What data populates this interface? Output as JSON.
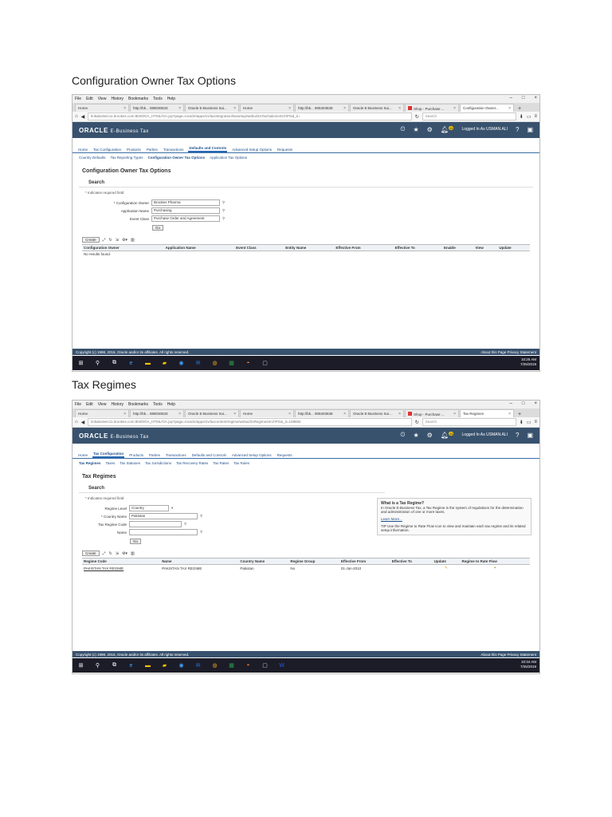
{
  "page": {
    "heading1": "Configuration Owner Tax Options",
    "heading2": "Tax Regimes"
  },
  "browser": {
    "menu": [
      "File",
      "Edit",
      "View",
      "History",
      "Bookmarks",
      "Tools",
      "Help"
    ],
    "window_controls": [
      "–",
      "□",
      "×"
    ]
  },
  "shot1": {
    "tabs": [
      "Home",
      "http://bk... 988030633",
      "Oracle E-Business Sui...",
      "Home",
      "http://bk... 905303638",
      "Oracle E-Business Sui...",
      "Shop - Purchase ...",
      "Configuration Owner..."
    ],
    "url": "linkabotsec11.brookes.com:8040/OA_HTML/OA.jsp?page=/oracle/apps/zx/taxintegration/taxsetup/webui/ZxTaxOptionsSrchPG&_ti=",
    "search_placeholder": "Search",
    "logo": "ORACLE",
    "product": "E-Business Tax",
    "logged_in": "Logged In As USMAN.ALI",
    "notif_count": "44",
    "nav_tabs": [
      "Home",
      "Tax Configuration",
      "Products",
      "Parties",
      "Transactions",
      "Defaults and Controls",
      "Advanced Setup Options",
      "Requests"
    ],
    "sub_tabs": [
      "Country Defaults",
      "Tax Reporting Types",
      "Configuration Owner Tax Options",
      "Application Tax Options"
    ],
    "title": "Configuration Owner Tax Options",
    "search_title": "Search",
    "required_note": "* Indicates required field",
    "fields": [
      {
        "label": "Configuration Owner",
        "value": "Brookes Pharma"
      },
      {
        "label": "Application Name",
        "value": "Purchasing"
      },
      {
        "label": "Event Class",
        "value": "Purchase Order and Agreement"
      }
    ],
    "go": "Go",
    "create": "Create",
    "columns": [
      "Configuration Owner",
      "Application Name",
      "Event Class",
      "Entity Name",
      "Effective From",
      "Effective To",
      "Enable",
      "View",
      "Update"
    ],
    "no_results": "No results found.",
    "copyright": "Copyright (c) 1998, 2016, Oracle and/or its affiliates. All rights reserved.",
    "footer_links": "About this Page   Privacy Statement",
    "clock_time": "10:25 AM",
    "clock_date": "7/25/2019"
  },
  "shot2": {
    "tabs": [
      "Home",
      "http://bk... 988030633",
      "Oracle E-Business Sui...",
      "Home",
      "http://bk... 905303638",
      "Oracle E-Business Sui...",
      "Shop - Purchase ...",
      "Tax Regimes"
    ],
    "url": "linkabotsec11.brookes.com:8040/OA_HTML/OA.jsp?page=/oracle/apps/zx/taxcontent/regime/webui/ZxRegimesSrchPG&_ti=108892",
    "search_placeholder": "Search",
    "logo": "ORACLE",
    "product": "E-Business Tax",
    "logged_in": "Logged In As USMAN.ALI",
    "notif_count": "44",
    "nav_tabs": [
      "Home",
      "Tax Configuration",
      "Products",
      "Parties",
      "Transactions",
      "Defaults and Controls",
      "Advanced Setup Options",
      "Requests"
    ],
    "sub_tabs": [
      "Tax Regimes",
      "Taxes",
      "Tax Statuses",
      "Tax Jurisdictions",
      "Tax Recovery Rates",
      "Tax Rates",
      "Tax Rules"
    ],
    "title": "Tax Regimes",
    "search_title": "Search",
    "required_note": "* Indicates required field",
    "fields": [
      {
        "label": "Regime Level",
        "value": "Country"
      },
      {
        "label": "Country Name",
        "value": "Pakistan"
      },
      {
        "label": "Tax Regime Code",
        "value": ""
      },
      {
        "label": "Name",
        "value": ""
      }
    ],
    "go": "Go",
    "create": "Create",
    "columns": [
      "Regime Code",
      "Name",
      "Country Name",
      "Regime Group",
      "Effective From",
      "Effective To",
      "Update",
      "Regime to Rate Flow"
    ],
    "rows": [
      [
        "PAKISTAN TAX REGIME",
        "PAKISTAN TAX REGIME",
        "Pakistan",
        "No",
        "01-Jan-2010",
        "",
        "",
        ""
      ]
    ],
    "info_title": "What is a Tax Regime?",
    "info_text": "In Oracle E-Business Tax, a Tax Regime is the system of regulations for the determination and administration of one or more taxes.",
    "info_link": "Learn More...",
    "info_tip": "TIP Use the Regime to Rate Flow icon to view and maintain each tax regime and its related setup information.",
    "copyright": "Copyright (c) 1998, 2016, Oracle and/or its affiliates. All rights reserved.",
    "footer_links": "About this Page   Privacy Statement",
    "clock_time": "10:34 AM",
    "clock_date": "7/25/2019"
  }
}
